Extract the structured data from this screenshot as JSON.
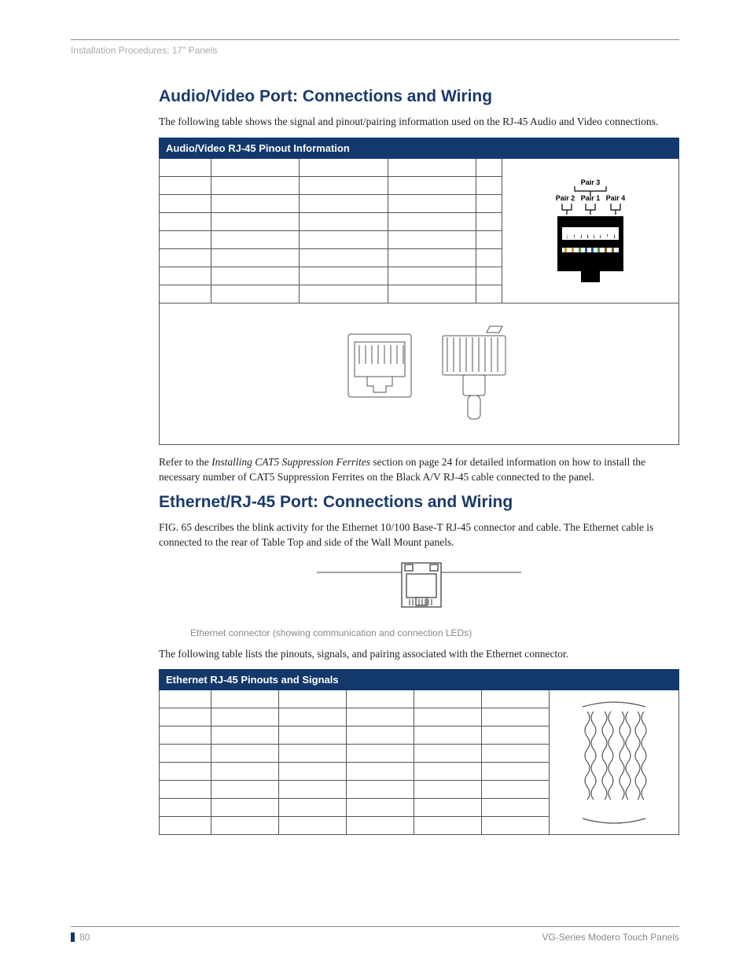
{
  "header": {
    "breadcrumb": "Installation Procedures: 17\" Panels"
  },
  "section1": {
    "title": "Audio/Video Port: Connections and Wiring",
    "intro": "The following table shows the signal and pinout/pairing information used on the RJ-45 Audio and Video connections.",
    "table_title": "Audio/Video RJ-45 Pinout Information",
    "diagram_labels": {
      "pair1": "Pair 1",
      "pair2": "Pair 2",
      "pair3": "Pair 3",
      "pair4": "Pair 4",
      "pins": [
        "1",
        "2",
        "3",
        "4",
        "5",
        "6",
        "7",
        "8"
      ]
    },
    "note_prefix": "Refer to the ",
    "note_ital": "Installing CAT5 Suppression Ferrites",
    "note_suffix": " section on page 24 for detailed information on how to install the necessary number of CAT5 Suppression Ferrites on the Black A/V RJ-45 cable connected to the panel."
  },
  "section2": {
    "title": "Ethernet/RJ-45 Port: Connections and Wiring",
    "intro": "FIG. 65 describes the blink activity for the Ethernet 10/100 Base-T RJ-45 connector and cable. The Ethernet cable is connected to the rear of Table Top and side of the Wall Mount panels.",
    "fig_caption": "Ethernet connector (showing communication and connection LEDs)",
    "after_fig": "The following table lists the pinouts, signals, and pairing associated with the Ethernet connector.",
    "table_title": "Ethernet RJ-45 Pinouts and Signals"
  },
  "footer": {
    "page_number": "80",
    "doc_title": "VG-Series Modero Touch Panels"
  }
}
